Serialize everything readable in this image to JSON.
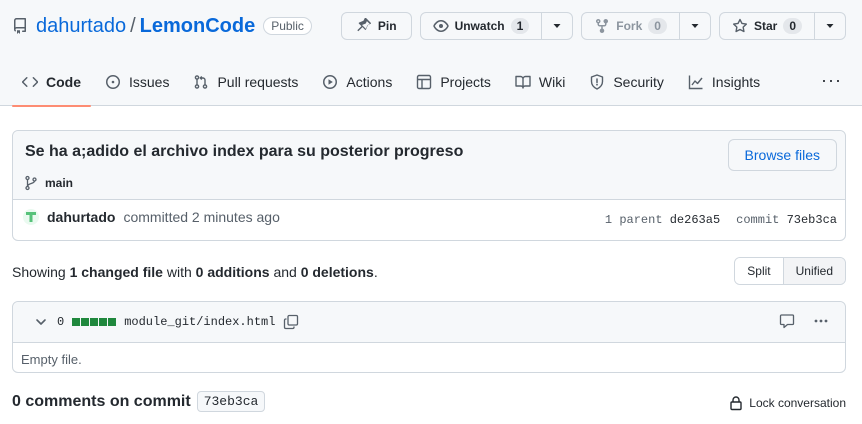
{
  "repo": {
    "owner": "dahurtado",
    "separator": "/",
    "name": "LemonCode",
    "visibility": "Public"
  },
  "actions": {
    "pin": "Pin",
    "unwatch": "Unwatch",
    "unwatch_count": "1",
    "fork": "Fork",
    "fork_count": "0",
    "star": "Star",
    "star_count": "0"
  },
  "nav": {
    "tabs": [
      {
        "label": "Code",
        "icon": "code-icon",
        "selected": true
      },
      {
        "label": "Issues",
        "icon": "issue-icon"
      },
      {
        "label": "Pull requests",
        "icon": "pull-request-icon"
      },
      {
        "label": "Actions",
        "icon": "play-icon"
      },
      {
        "label": "Projects",
        "icon": "table-icon"
      },
      {
        "label": "Wiki",
        "icon": "book-icon"
      },
      {
        "label": "Security",
        "icon": "shield-icon"
      },
      {
        "label": "Insights",
        "icon": "graph-icon"
      }
    ],
    "more": "···"
  },
  "commit": {
    "title": "Se ha a;adido el archivo index para su posterior progreso",
    "branch": "main",
    "browse_label": "Browse files",
    "author": "dahurtado",
    "action_text": "committed 2 minutes ago",
    "parent_label": "1 parent",
    "parent_sha": "de263a5",
    "commit_label": "commit",
    "commit_sha": "73eb3ca"
  },
  "stats": {
    "showing": "Showing",
    "files": "1 changed file",
    "with": "with",
    "additions": "0 additions",
    "and": "and",
    "deletions": "0 deletions",
    "period": "."
  },
  "view_toggle": {
    "split": "Split",
    "unified": "Unified",
    "selected": "Unified"
  },
  "file": {
    "change_count": "0",
    "path": "module_git/index.html",
    "body": "Empty file.",
    "accent": "#1f883d"
  },
  "comments": {
    "label": "0 comments on commit",
    "sha": "73eb3ca",
    "lock_label": "Lock conversation"
  }
}
